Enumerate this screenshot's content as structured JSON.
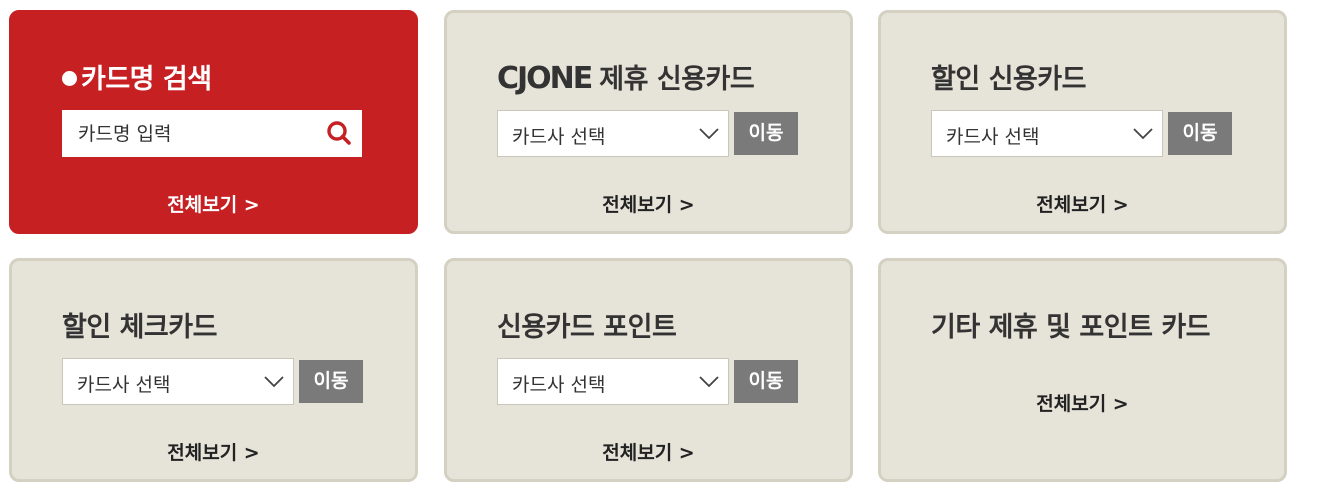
{
  "search_card": {
    "title": "카드명 검색",
    "placeholder": "카드명 입력",
    "view_all": "전체보기 >"
  },
  "cards": [
    {
      "logo": "CJONE",
      "title": "제휴 신용카드",
      "select_value": "카드사 선택",
      "go_label": "이동",
      "view_all": "전체보기 >"
    },
    {
      "title": "할인 신용카드",
      "select_value": "카드사 선택",
      "go_label": "이동",
      "view_all": "전체보기 >"
    },
    {
      "title": "할인 체크카드",
      "select_value": "카드사 선택",
      "go_label": "이동",
      "view_all": "전체보기 >"
    },
    {
      "title": "신용카드 포인트",
      "select_value": "카드사 선택",
      "go_label": "이동",
      "view_all": "전체보기 >"
    },
    {
      "title": "기타 제휴 및 포인트 카드",
      "view_all": "전체보기 >"
    }
  ],
  "colors": {
    "search_card_bg": "#c62023",
    "card_bg": "#e6e3d8",
    "button_bg": "#7a7a7a"
  },
  "icons": {
    "search": "search-icon",
    "select_arrow": "chevron-down-icon"
  }
}
